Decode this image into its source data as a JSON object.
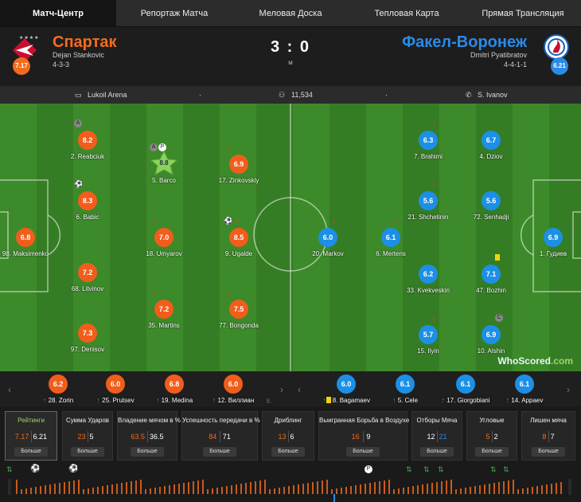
{
  "tabs": [
    "Матч-Центр",
    "Репортаж Матча",
    "Меловая Доска",
    "Тепловая Карта",
    "Прямая Трансляция"
  ],
  "home": {
    "name": "Спартак",
    "coach": "Dejan Stankovic",
    "formation": "4-3-3",
    "rating": "7.17",
    "color": "#f46b1e"
  },
  "away": {
    "name": "Факел-Воронеж",
    "coach": "Dmitri Pyatibratov",
    "formation": "4-4-1-1",
    "rating": "6.21",
    "color": "#2b8ae8"
  },
  "score": "3 : 0",
  "status": "м",
  "info": {
    "stadium": "Lukoil Arena",
    "attendance": "11,534",
    "referee": "S. Ivanov",
    "dot": "·"
  },
  "home_players": [
    {
      "name": "98. Maksimenko",
      "rating": "6.8"
    },
    {
      "name": "2. Reabciuk",
      "rating": "8.2"
    },
    {
      "name": "6. Babic",
      "rating": "8.3"
    },
    {
      "name": "68. Litvinov",
      "rating": "7.2"
    },
    {
      "name": "97. Denisov",
      "rating": "7.3"
    },
    {
      "name": "5. Barco",
      "rating": "8.8"
    },
    {
      "name": "18. Umyarov",
      "rating": "7.0"
    },
    {
      "name": "35. Martins",
      "rating": "7.2"
    },
    {
      "name": "17. Zinkovskiy",
      "rating": "6.9"
    },
    {
      "name": "9. Ugalde",
      "rating": "8.5"
    },
    {
      "name": "77. Bongonda",
      "rating": "7.5"
    }
  ],
  "away_players": [
    {
      "name": "20. Markov",
      "rating": "6.0"
    },
    {
      "name": "6. Mertens",
      "rating": "6.1"
    },
    {
      "name": "7. Brahimi",
      "rating": "6.3"
    },
    {
      "name": "21. Shchetinin",
      "rating": "5.6"
    },
    {
      "name": "33. Kvekveskiri",
      "rating": "6.2"
    },
    {
      "name": "15. Ilyin",
      "rating": "5.7"
    },
    {
      "name": "4. Dziov",
      "rating": "6.7"
    },
    {
      "name": "72. Senhadji",
      "rating": "5.6"
    },
    {
      "name": "47. Bozhin",
      "rating": "7.1"
    },
    {
      "name": "10. Alshin",
      "rating": "6.9"
    },
    {
      "name": "1. Гудиев",
      "rating": "6.9"
    }
  ],
  "badges": {
    "assist": "A",
    "penalty": "P",
    "captain": "C"
  },
  "watermark": {
    "main": "WhoScored",
    "suffix": ".com"
  },
  "home_subs": [
    {
      "name": "28. Zorin",
      "rating": "6.2"
    },
    {
      "name": "25. Prutsev",
      "rating": "6.0"
    },
    {
      "name": "19. Medina",
      "rating": "6.8"
    },
    {
      "name": "12. Виллиан",
      "rating": "6.0"
    },
    {
      "name": "8.",
      "rating": ""
    }
  ],
  "away_subs": [
    {
      "name": "8. Bagamaev",
      "rating": "6.0"
    },
    {
      "name": "5. Cele",
      "rating": "6.1"
    },
    {
      "name": "17. Giorgobiani",
      "rating": "6.1"
    },
    {
      "name": "14. Appaev",
      "rating": "6.1"
    }
  ],
  "stats": [
    {
      "title": "Рейтинги",
      "home": "7.17",
      "away": "6.21",
      "more": "Больше"
    },
    {
      "title": "Сумма Ударов",
      "home": "23",
      "away": "5",
      "more": "Больше"
    },
    {
      "title": "Владение мячом в %",
      "home": "63.5",
      "away": "36.5",
      "more": "Больше"
    },
    {
      "title": "Успешность передачи в %",
      "home": "84",
      "away": "71",
      "more": "Больше"
    },
    {
      "title": "Дриблинг",
      "home": "13",
      "away": "6",
      "more": "Больше"
    },
    {
      "title": "Выигранная Борьба в Воздухе",
      "home": "16",
      "away": "9",
      "more": "Больше"
    },
    {
      "title": "Отборы Мяча",
      "home": "12",
      "away": "21",
      "more": "Больше"
    },
    {
      "title": "Угловые",
      "home": "5",
      "away": "2",
      "more": "Больше"
    },
    {
      "title": "Лишен мяча",
      "home": "8",
      "away": "7",
      "more": "Больше"
    }
  ],
  "timeline_markers": {
    "ball": "⚽",
    "swap": "⇅",
    "penalty": "P"
  }
}
